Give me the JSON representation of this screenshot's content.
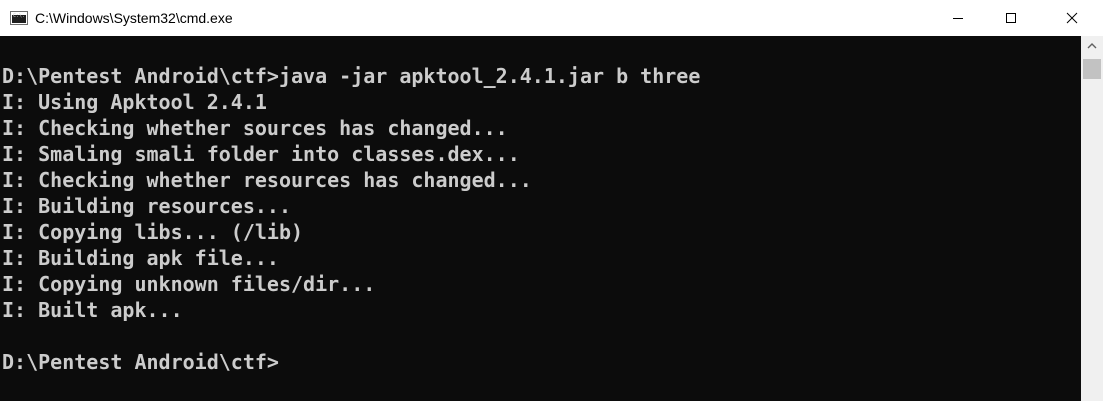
{
  "window": {
    "title": "C:\\Windows\\System32\\cmd.exe",
    "icon": "cmd-icon",
    "icon_text": "C:\\."
  },
  "controls": {
    "minimize_icon": "minimize-icon",
    "maximize_icon": "maximize-icon",
    "close_icon": "close-icon"
  },
  "console": {
    "lines": [
      "D:\\Pentest Android\\ctf>java -jar apktool_2.4.1.jar b three",
      "I: Using Apktool 2.4.1",
      "I: Checking whether sources has changed...",
      "I: Smaling smali folder into classes.dex...",
      "I: Checking whether resources has changed...",
      "I: Building resources...",
      "I: Copying libs... (/lib)",
      "I: Building apk file...",
      "I: Copying unknown files/dir...",
      "I: Built apk...",
      "",
      "D:\\Pentest Android\\ctf>"
    ]
  },
  "colors": {
    "background": "#0c0c0c",
    "text": "#cccccc",
    "titlebar": "#ffffff"
  }
}
